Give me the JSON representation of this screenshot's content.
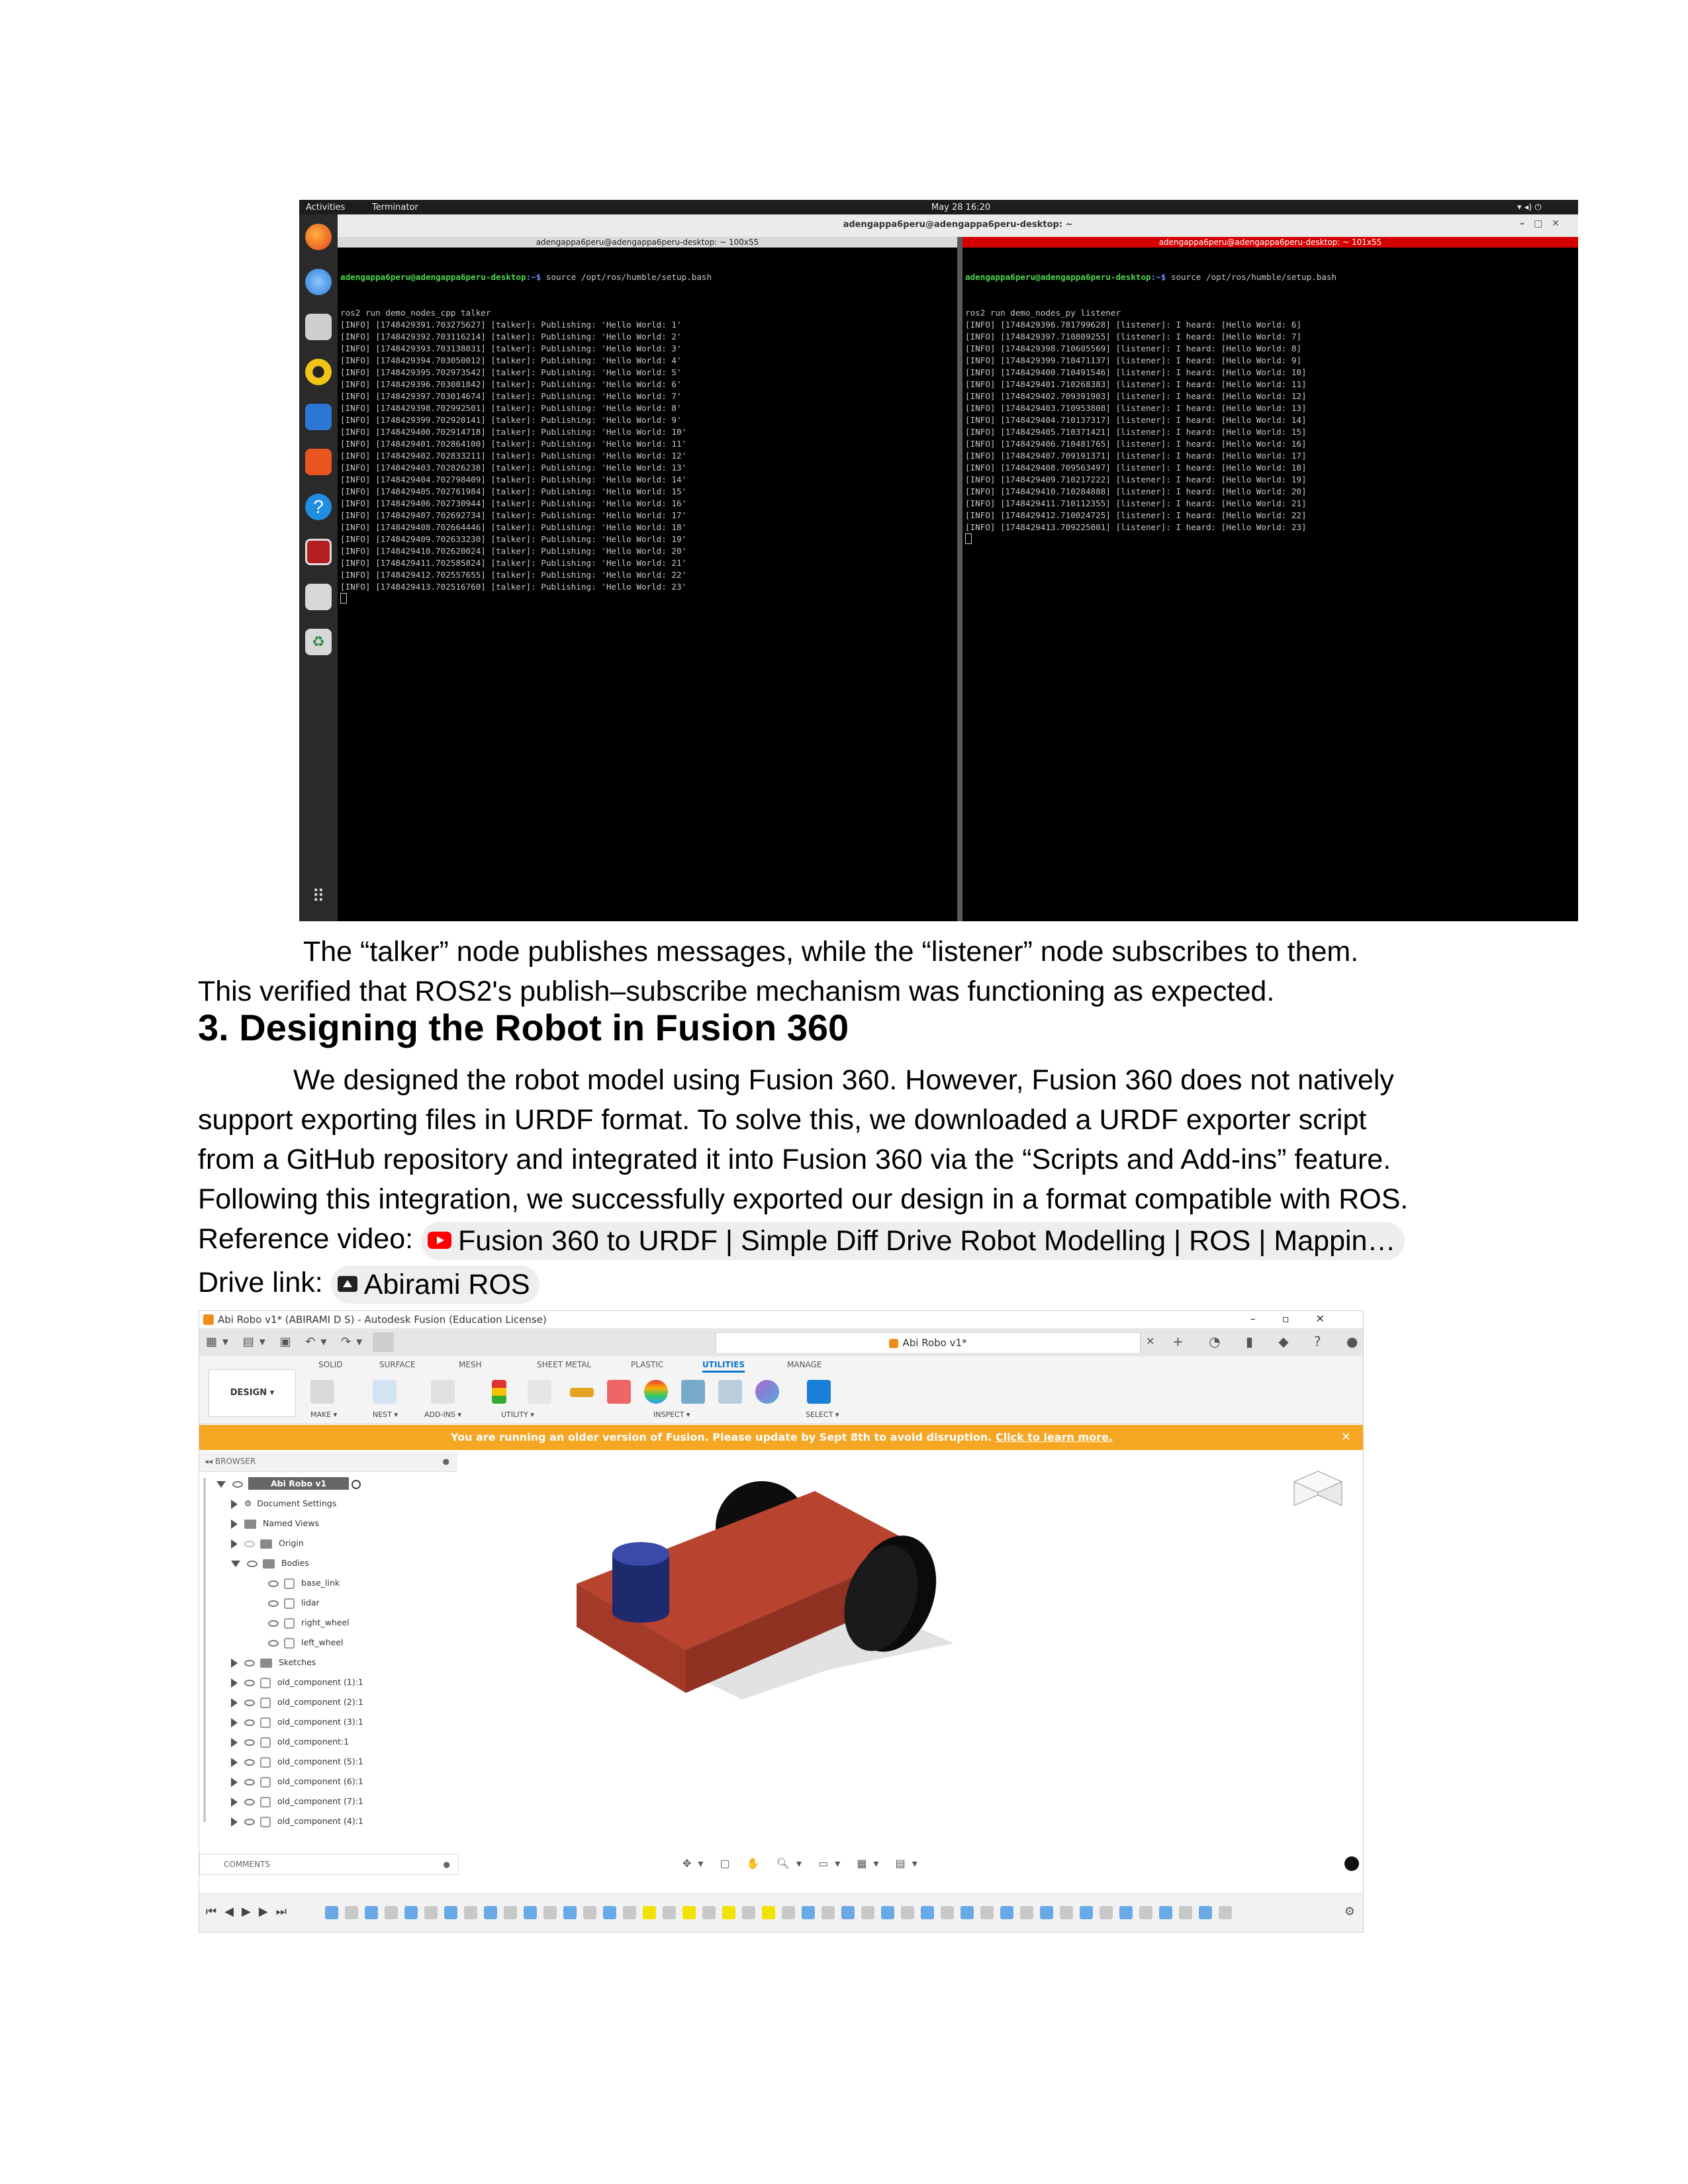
{
  "ubuntu": {
    "topbar": {
      "activities": "Activities",
      "app": "Terminator",
      "clock": "May 28  16:20"
    },
    "window_title": "adengappa6peru@adengappa6peru-desktop: ~",
    "left_pane": {
      "title": "adengappa6peru@adengappa6peru-desktop: ~ 100x55",
      "prompt_user": "adengappa6peru@adengappa6peru-desktop",
      "prompt_path": ":~$",
      "command": " source /opt/ros/humble/setup.bash",
      "lines": [
        "ros2 run demo_nodes_cpp talker",
        "[INFO] [1748429391.703275627] [talker]: Publishing: 'Hello World: 1'",
        "[INFO] [1748429392.703116214] [talker]: Publishing: 'Hello World: 2'",
        "[INFO] [1748429393.703138031] [talker]: Publishing: 'Hello World: 3'",
        "[INFO] [1748429394.703050012] [talker]: Publishing: 'Hello World: 4'",
        "[INFO] [1748429395.702973542] [talker]: Publishing: 'Hello World: 5'",
        "[INFO] [1748429396.703001842] [talker]: Publishing: 'Hello World: 6'",
        "[INFO] [1748429397.703014674] [talker]: Publishing: 'Hello World: 7'",
        "[INFO] [1748429398.702992501] [talker]: Publishing: 'Hello World: 8'",
        "[INFO] [1748429399.702920141] [talker]: Publishing: 'Hello World: 9'",
        "[INFO] [1748429400.702914718] [talker]: Publishing: 'Hello World: 10'",
        "[INFO] [1748429401.702864100] [talker]: Publishing: 'Hello World: 11'",
        "[INFO] [1748429402.702833211] [talker]: Publishing: 'Hello World: 12'",
        "[INFO] [1748429403.702826238] [talker]: Publishing: 'Hello World: 13'",
        "[INFO] [1748429404.702798409] [talker]: Publishing: 'Hello World: 14'",
        "[INFO] [1748429405.702761984] [talker]: Publishing: 'Hello World: 15'",
        "[INFO] [1748429406.702730944] [talker]: Publishing: 'Hello World: 16'",
        "[INFO] [1748429407.702692734] [talker]: Publishing: 'Hello World: 17'",
        "[INFO] [1748429408.702664446] [talker]: Publishing: 'Hello World: 18'",
        "[INFO] [1748429409.702633230] [talker]: Publishing: 'Hello World: 19'",
        "[INFO] [1748429410.702620024] [talker]: Publishing: 'Hello World: 20'",
        "[INFO] [1748429411.702585824] [talker]: Publishing: 'Hello World: 21'",
        "[INFO] [1748429412.702557655] [talker]: Publishing: 'Hello World: 22'",
        "[INFO] [1748429413.702516760] [talker]: Publishing: 'Hello World: 23'"
      ]
    },
    "right_pane": {
      "title": "adengappa6peru@adengappa6peru-desktop: ~ 101x55",
      "prompt_user": "adengappa6peru@adengappa6peru-desktop",
      "prompt_path": ":~$",
      "command": " source /opt/ros/humble/setup.bash",
      "lines": [
        "ros2 run demo_nodes_py listener",
        "[INFO] [1748429396.781799628] [listener]: I heard: [Hello World: 6]",
        "[INFO] [1748429397.710809255] [listener]: I heard: [Hello World: 7]",
        "[INFO] [1748429398.710605569] [listener]: I heard: [Hello World: 8]",
        "[INFO] [1748429399.710471137] [listener]: I heard: [Hello World: 9]",
        "[INFO] [1748429400.710491546] [listener]: I heard: [Hello World: 10]",
        "[INFO] [1748429401.710268383] [listener]: I heard: [Hello World: 11]",
        "[INFO] [1748429402.709391903] [listener]: I heard: [Hello World: 12]",
        "[INFO] [1748429403.710953808] [listener]: I heard: [Hello World: 13]",
        "[INFO] [1748429404.710137317] [listener]: I heard: [Hello World: 14]",
        "[INFO] [1748429405.710371421] [listener]: I heard: [Hello World: 15]",
        "[INFO] [1748429406.710481765] [listener]: I heard: [Hello World: 16]",
        "[INFO] [1748429407.709191371] [listener]: I heard: [Hello World: 17]",
        "[INFO] [1748429408.709563497] [listener]: I heard: [Hello World: 18]",
        "[INFO] [1748429409.710217222] [listener]: I heard: [Hello World: 19]",
        "[INFO] [1748429410.710284888] [listener]: I heard: [Hello World: 20]",
        "[INFO] [1748429411.710112355] [listener]: I heard: [Hello World: 21]",
        "[INFO] [1748429412.710024725] [listener]: I heard: [Hello World: 22]",
        "[INFO] [1748429413.709225001] [listener]: I heard: [Hello World: 23]"
      ]
    }
  },
  "text": {
    "para1_line1": "The “talker” node publishes messages, while the “listener” node subscribes to them.",
    "para1_line2": "This verified that ROS2's publish–subscribe mechanism was functioning as expected.",
    "heading": "3. Designing the Robot in Fusion 360",
    "para2": [
      "We designed the robot model using Fusion 360. However, Fusion 360 does not natively",
      "support exporting files in URDF format. To solve this, we downloaded a URDF exporter script",
      "from a GitHub repository and integrated it into Fusion 360 via the “Scripts and Add-ins” feature.",
      "Following this integration, we successfully exported our design in a format compatible with ROS."
    ],
    "ref_label": "Reference video: ",
    "ref_chip": "Fusion 360 to URDF | Simple Diff Drive Robot Modelling | ROS | Mappin…",
    "drive_label": "Drive link: ",
    "drive_chip": "Abirami ROS"
  },
  "fusion": {
    "window_title": "Abi Robo v1* (ABIRAMI D S) - Autodesk Fusion (Education License)",
    "doc_tab": "Abi Robo v1*",
    "workspace": "DESIGN ▾",
    "tabs": [
      "SOLID",
      "SURFACE",
      "MESH",
      "SHEET METAL",
      "PLASTIC",
      "UTILITIES",
      "MANAGE"
    ],
    "groups": [
      "MAKE ▾",
      "NEST ▾",
      "ADD-INS ▾",
      "UTILITY ▾",
      "INSPECT ▾",
      "SELECT ▾"
    ],
    "banner_text": "You are running an older version of Fusion. Please update by Sept 8th to avoid disruption. ",
    "banner_link": "Click to learn more.",
    "browser_title": "BROWSER",
    "tree": {
      "root": "Abi Robo v1",
      "doc_settings": "Document Settings",
      "named_views": "Named Views",
      "origin": "Origin",
      "bodies": "Bodies",
      "body_items": [
        "base_link",
        "lidar",
        "right_wheel",
        "left_wheel"
      ],
      "sketches": "Sketches",
      "components": [
        "old_component (1):1",
        "old_component (2):1",
        "old_component (3):1",
        "old_component:1",
        "old_component (5):1",
        "old_component (6):1",
        "old_component (7):1",
        "old_component (4):1"
      ]
    },
    "comments": "COMMENTS",
    "colors": {
      "base": "#b8432f",
      "wheel": "#111111",
      "lidar": "#1e2a6e",
      "accent": "#0a74d0",
      "banner": "#f5a623"
    }
  }
}
